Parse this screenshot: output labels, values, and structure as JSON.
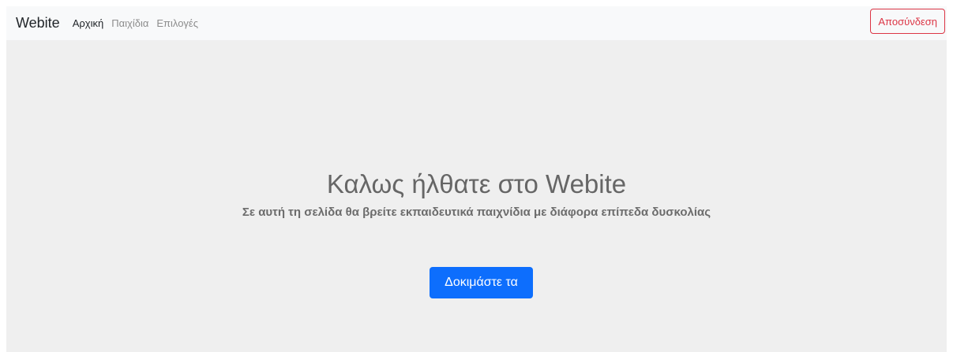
{
  "navbar": {
    "brand": "Webite",
    "links": [
      {
        "label": "Αρχική",
        "active": true
      },
      {
        "label": "Παιχίδια",
        "active": false
      },
      {
        "label": "Επιλογές",
        "active": false
      }
    ],
    "logout_label": "Αποσύνδεση"
  },
  "hero": {
    "title": "Καλως ήλθατε στο Webite",
    "subtitle": "Σε αυτή τη σελίδα θα βρείτε εκπαιδευτικά παιχνίδια με διάφορα επίπεδα δυσκολίας",
    "cta_label": "Δοκιμάστε τα"
  },
  "colors": {
    "primary": "#0d6efd",
    "danger": "#dc3545",
    "background": "#efefef",
    "navbar_bg": "#f8f9fa"
  }
}
